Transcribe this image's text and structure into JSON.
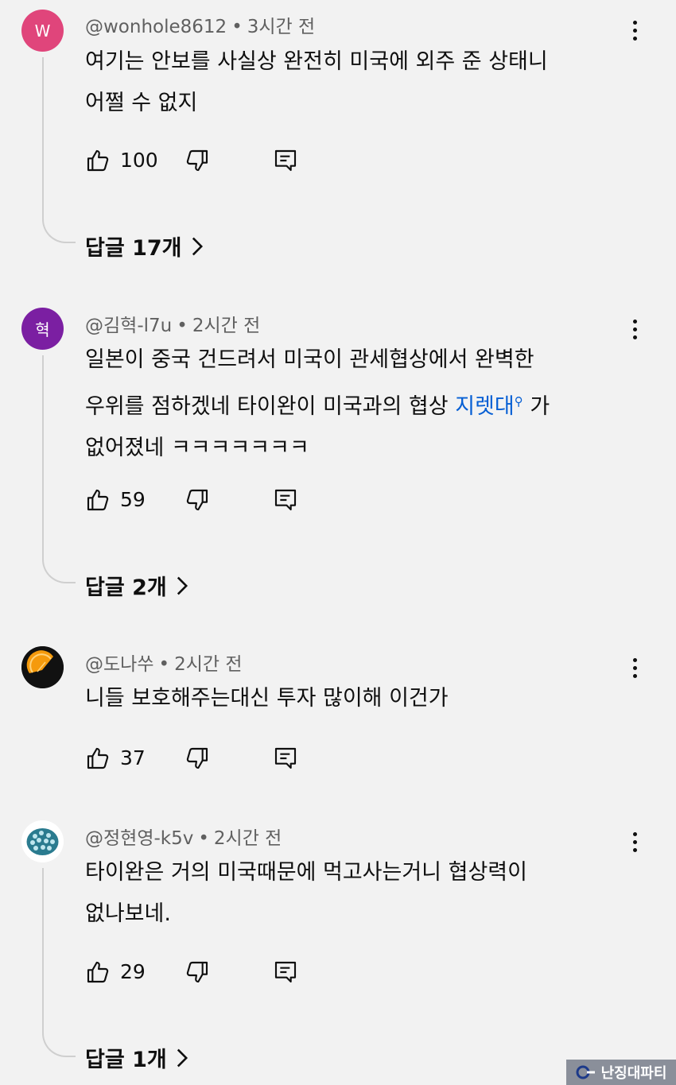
{
  "comments": [
    {
      "avatar_letter": "W",
      "avatar_color": "#e0457b",
      "handle": "@wonhole8612",
      "time": "3시간 전",
      "line1": "여기는 안보를 사실상 완전히 미국에 외주 준 상태니",
      "line2": "어쩔 수 없지",
      "likes": "100",
      "replies": "답글 17개"
    },
    {
      "avatar_letter": "혁",
      "avatar_color": "#7b1fa2",
      "handle": "@김혁-l7u",
      "time": "2시간 전",
      "line1": "일본이 중국 건드려서 미국이 관세협상에서 완벽한",
      "line2_prefix": "우위를 점하겠네 타이완이 미국과의 협상 ",
      "line2_link": "지렛대",
      "line2_suffix": "가",
      "line3": "없어졌네 ㅋㅋㅋㅋㅋㅋㅋ",
      "likes": "59",
      "replies": "답글 2개"
    },
    {
      "avatar_icon": "orange-slice-icon",
      "handle": "@도나쑤",
      "time": "2시간 전",
      "line1": "니들 보호해주는대신 투자 많이해 이건가",
      "likes": "37"
    },
    {
      "avatar_icon": "brain-icon",
      "handle": "@정현영-k5v",
      "time": "2시간 전",
      "line1": "타이완은 거의 미국때문에 먹고사는거니 협상력이",
      "line2": "없나보네.",
      "likes": "29",
      "replies": "답글 1개"
    }
  ],
  "watermark": {
    "text": "난징대파티"
  },
  "colors": {
    "background": "#f2f2f2",
    "link": "#065fd4",
    "meta": "#606060"
  }
}
